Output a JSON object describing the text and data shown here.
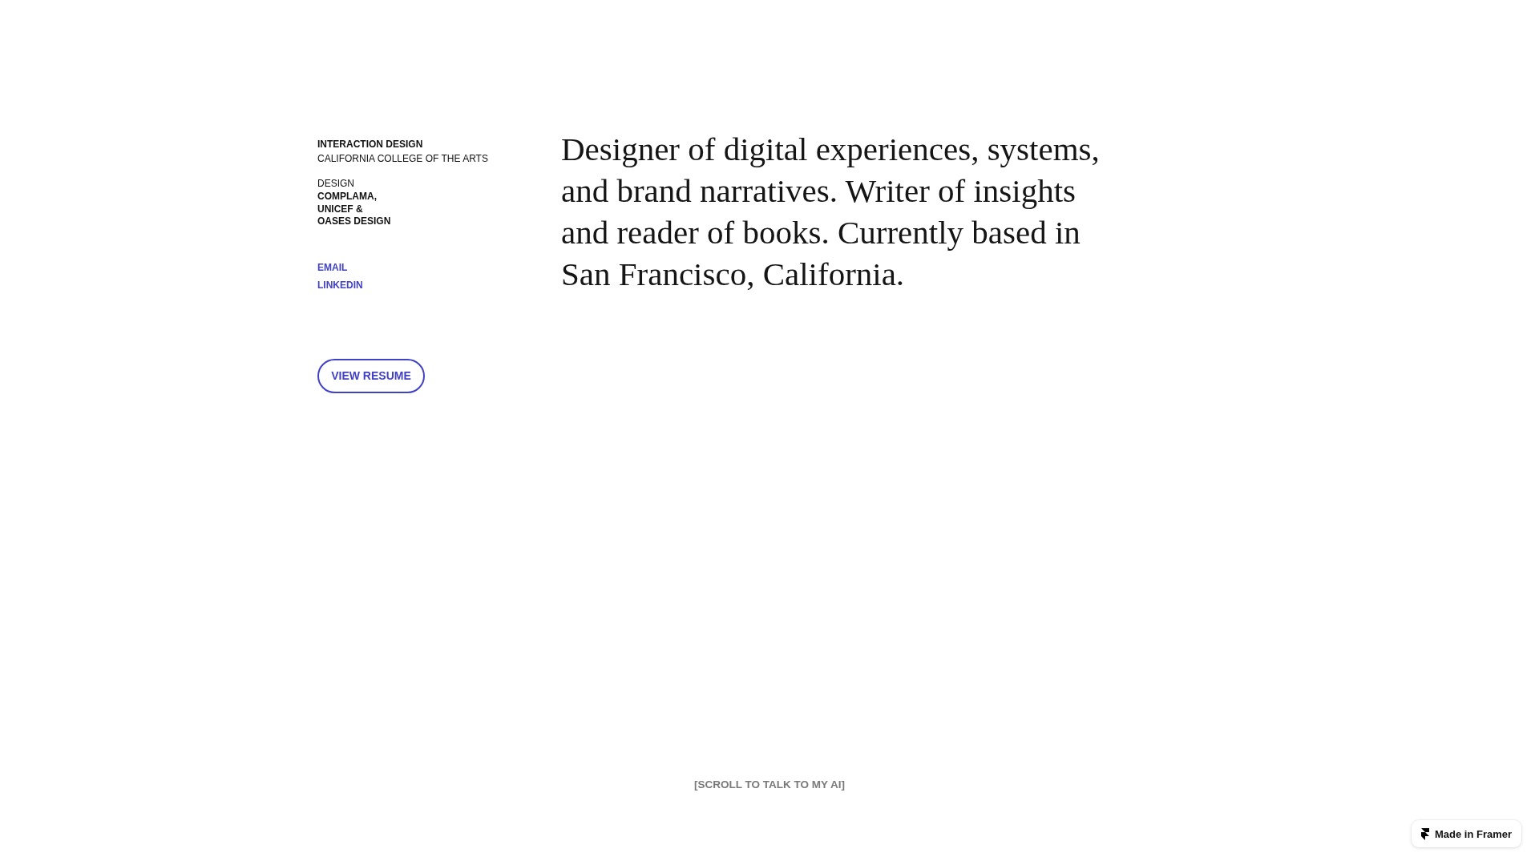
{
  "education": {
    "field": "INTERACTION DESIGN",
    "school": "CALIFORNIA COLLEGE OF THE ARTS"
  },
  "experience": {
    "field": "DESIGN",
    "companies": [
      "COMPLAMA,",
      "UNICEF &",
      "OASES DESIGN"
    ]
  },
  "links": [
    "EMAIL",
    "LINKEDIN"
  ],
  "resume_button": "VIEW RESUME",
  "intro": "Designer of digital experiences, systems, and brand narratives. Writer of insights and reader of books. Currently based in San Francisco, California.",
  "scroll_hint": "[SCROLL TO TALK TO MY AI]",
  "badge": {
    "label": "Made in Framer"
  }
}
